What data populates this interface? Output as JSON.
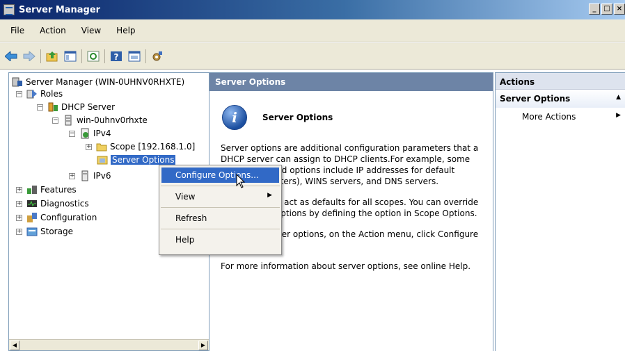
{
  "window": {
    "title": "Server Manager",
    "btn_min": "_",
    "btn_max": "□",
    "btn_close": "×"
  },
  "menu": [
    "File",
    "Action",
    "View",
    "Help"
  ],
  "toolbar_icons": [
    "back-arrow-icon",
    "forward-arrow-icon",
    "up-folder-icon",
    "show-hide-tree-icon",
    "refresh-icon",
    "help-icon",
    "console-icon",
    "properties-icon"
  ],
  "tree": {
    "root": "Server Manager (WIN-0UHNV0RHXTE)",
    "roles": "Roles",
    "dhcp_server": "DHCP Server",
    "host": "win-0uhnv0rhxte",
    "ipv4": "IPv4",
    "scope": "Scope [192.168.1.0]",
    "server_options": "Server Options",
    "ipv6": "IPv6",
    "features": "Features",
    "diagnostics": "Diagnostics",
    "configuration": "Configuration",
    "storage": "Storage"
  },
  "center": {
    "header": "Server Options",
    "info_title": "Server Options",
    "para1": "Server options are additional configuration parameters that a DHCP server can assign to DHCP clients.For example, some commonly used options include IP addresses for default gateways (routers), WINS servers, and DNS servers.",
    "para2": "Server options act as defaults for all scopes.  You can override these server options by defining the option in Scope Options.",
    "para3": "To set the server options, on the Action menu, click Configure Options.",
    "para4": "For more information about server options, see online Help."
  },
  "actions": {
    "header": "Actions",
    "section": "Server Options",
    "section_arrow": "▲",
    "item": "More Actions",
    "item_arrow": "▶"
  },
  "context_menu": {
    "configure": "Configure Options...",
    "view": "View",
    "view_arrow": "▶",
    "refresh": "Refresh",
    "help": "Help"
  },
  "scroll": {
    "left": "◀",
    "right": "▶"
  }
}
